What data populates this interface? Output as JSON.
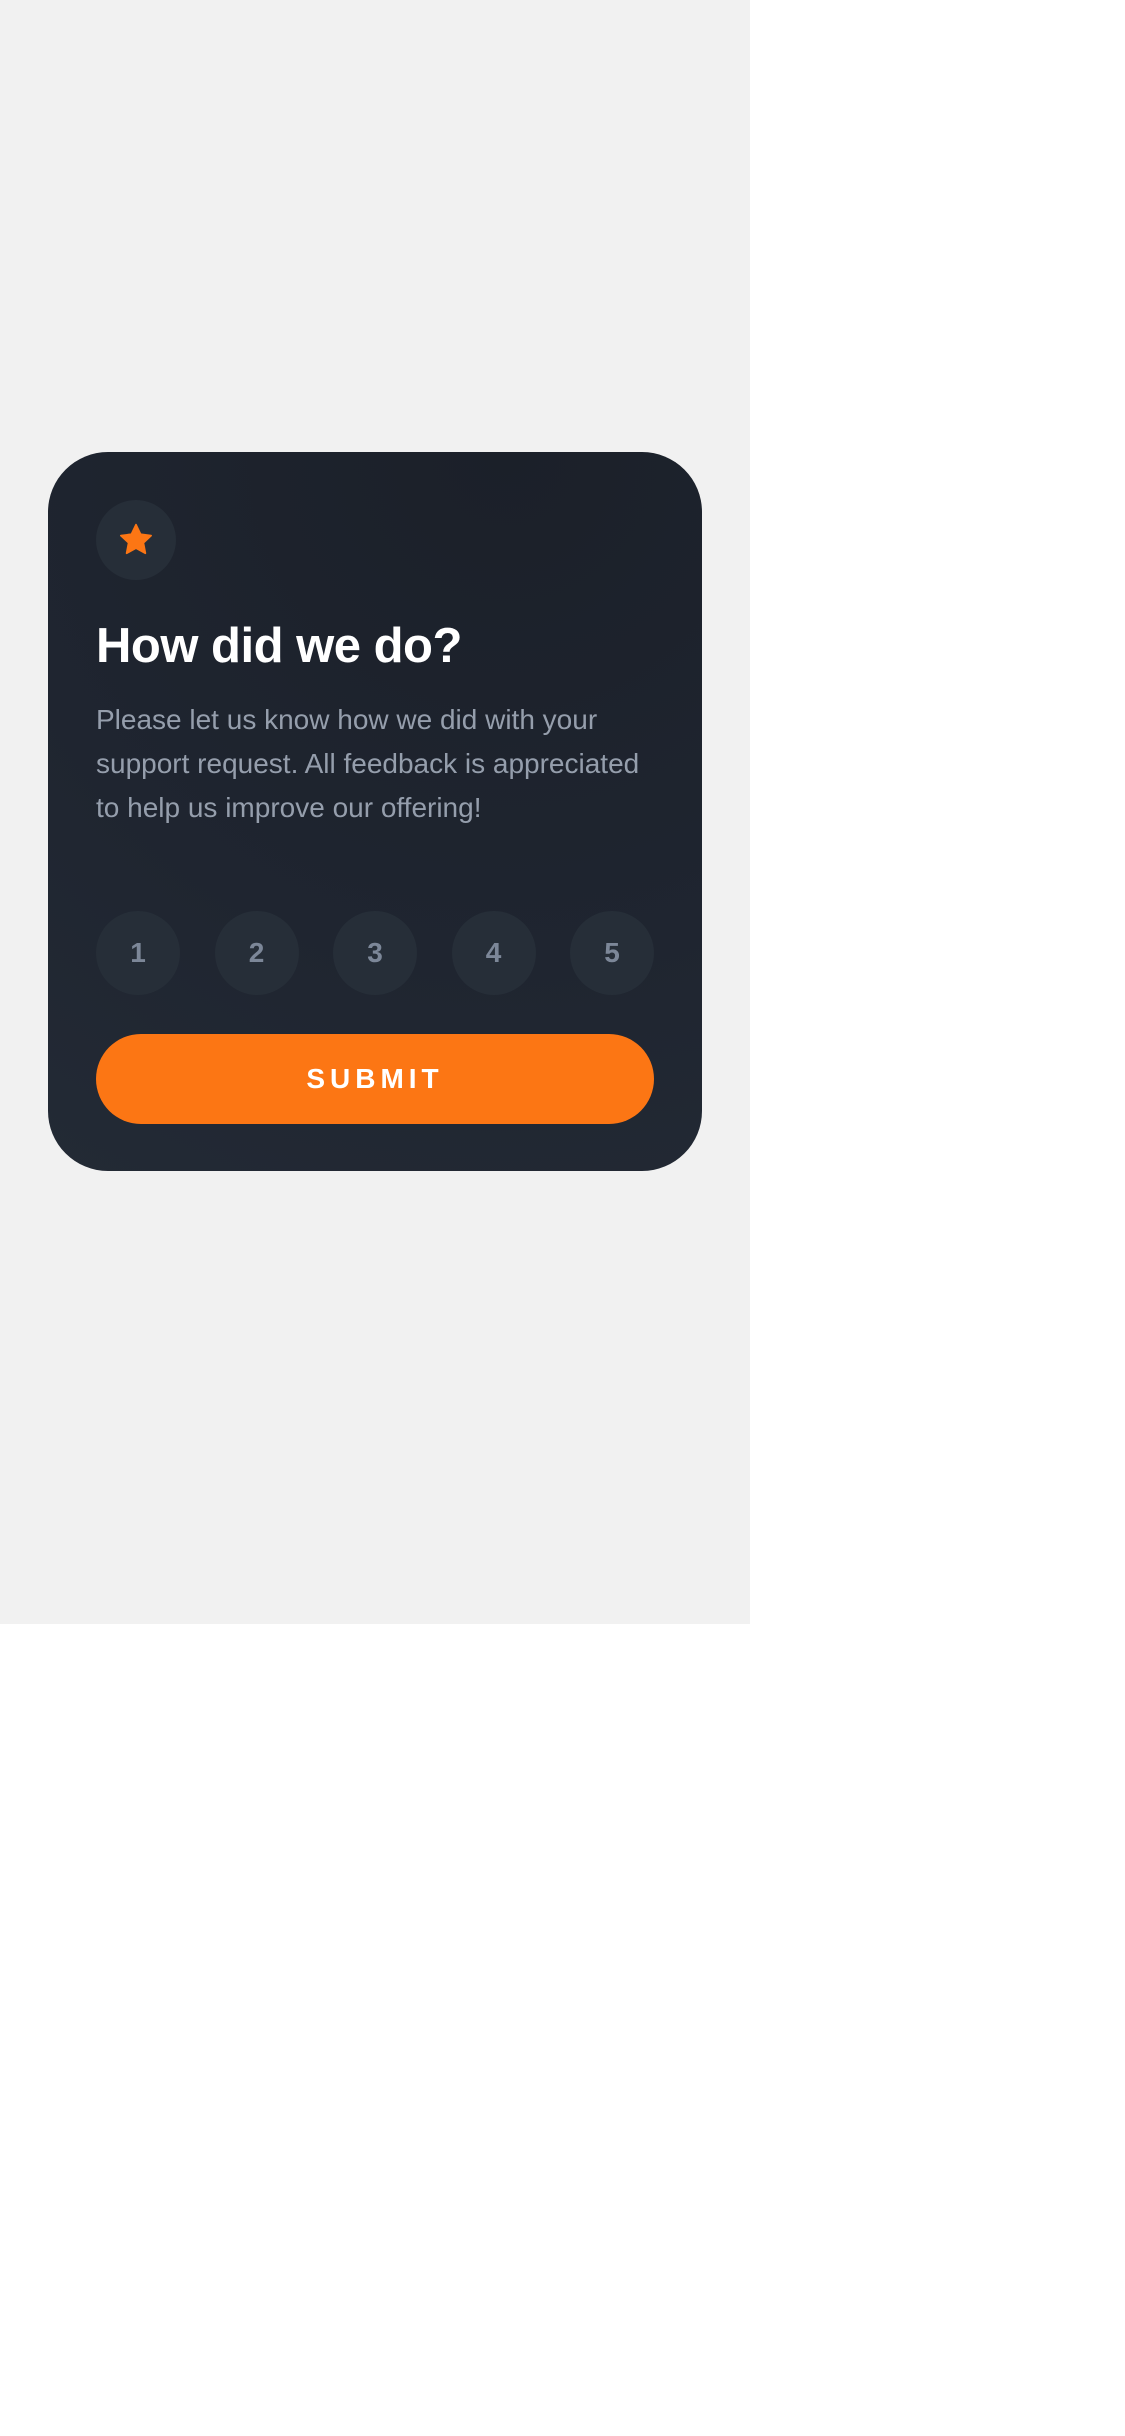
{
  "colors": {
    "page_background": "#f1f1f1",
    "card_background": "#1f2530",
    "accent": "#fc7614",
    "rating_background": "#262e38",
    "rating_text": "#7c8798",
    "title": "#ffffff",
    "description": "#959eac"
  },
  "card": {
    "icon": "star-icon",
    "title": "How did we do?",
    "description": "Please let us know how we did with your support request. All feedback is appreciated to help us improve our offering!"
  },
  "ratings": [
    "1",
    "2",
    "3",
    "4",
    "5"
  ],
  "submit": {
    "label": "SUBMIT"
  }
}
